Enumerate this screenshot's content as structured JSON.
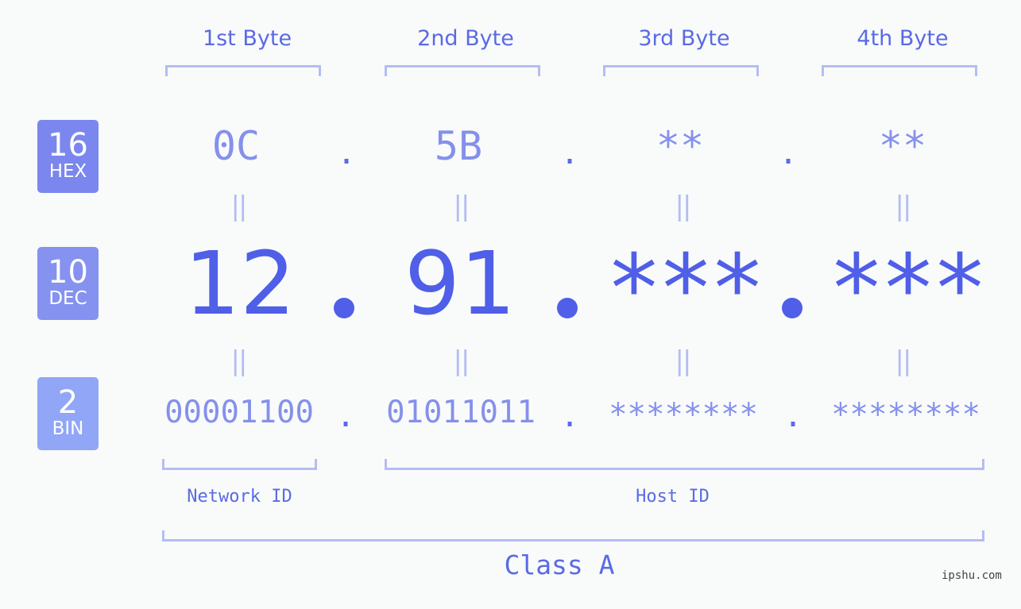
{
  "headers": [
    "1st Byte",
    "2nd Byte",
    "3rd Byte",
    "4th Byte"
  ],
  "rows": {
    "hex": {
      "base": "16",
      "label": "HEX",
      "values": [
        "0C",
        "5B",
        "**",
        "**"
      ],
      "color": "#7b87ee"
    },
    "dec": {
      "base": "10",
      "label": "DEC",
      "values": [
        "12",
        "91",
        "***",
        "***"
      ],
      "color": "#8692f0"
    },
    "bin": {
      "base": "2",
      "label": "BIN",
      "values": [
        "00001100",
        "01011011",
        "********",
        "********"
      ],
      "color": "#91a6f7"
    }
  },
  "separator": ".",
  "equals_sign": "||",
  "segments": {
    "network": "Network ID",
    "host": "Host ID",
    "class": "Class A"
  },
  "watermark": "ipshu.com",
  "colors": {
    "accent": "#4f5fe8",
    "light_accent": "#8590ec",
    "bracket": "#b4bdf3",
    "background": "#f9fbfa"
  }
}
